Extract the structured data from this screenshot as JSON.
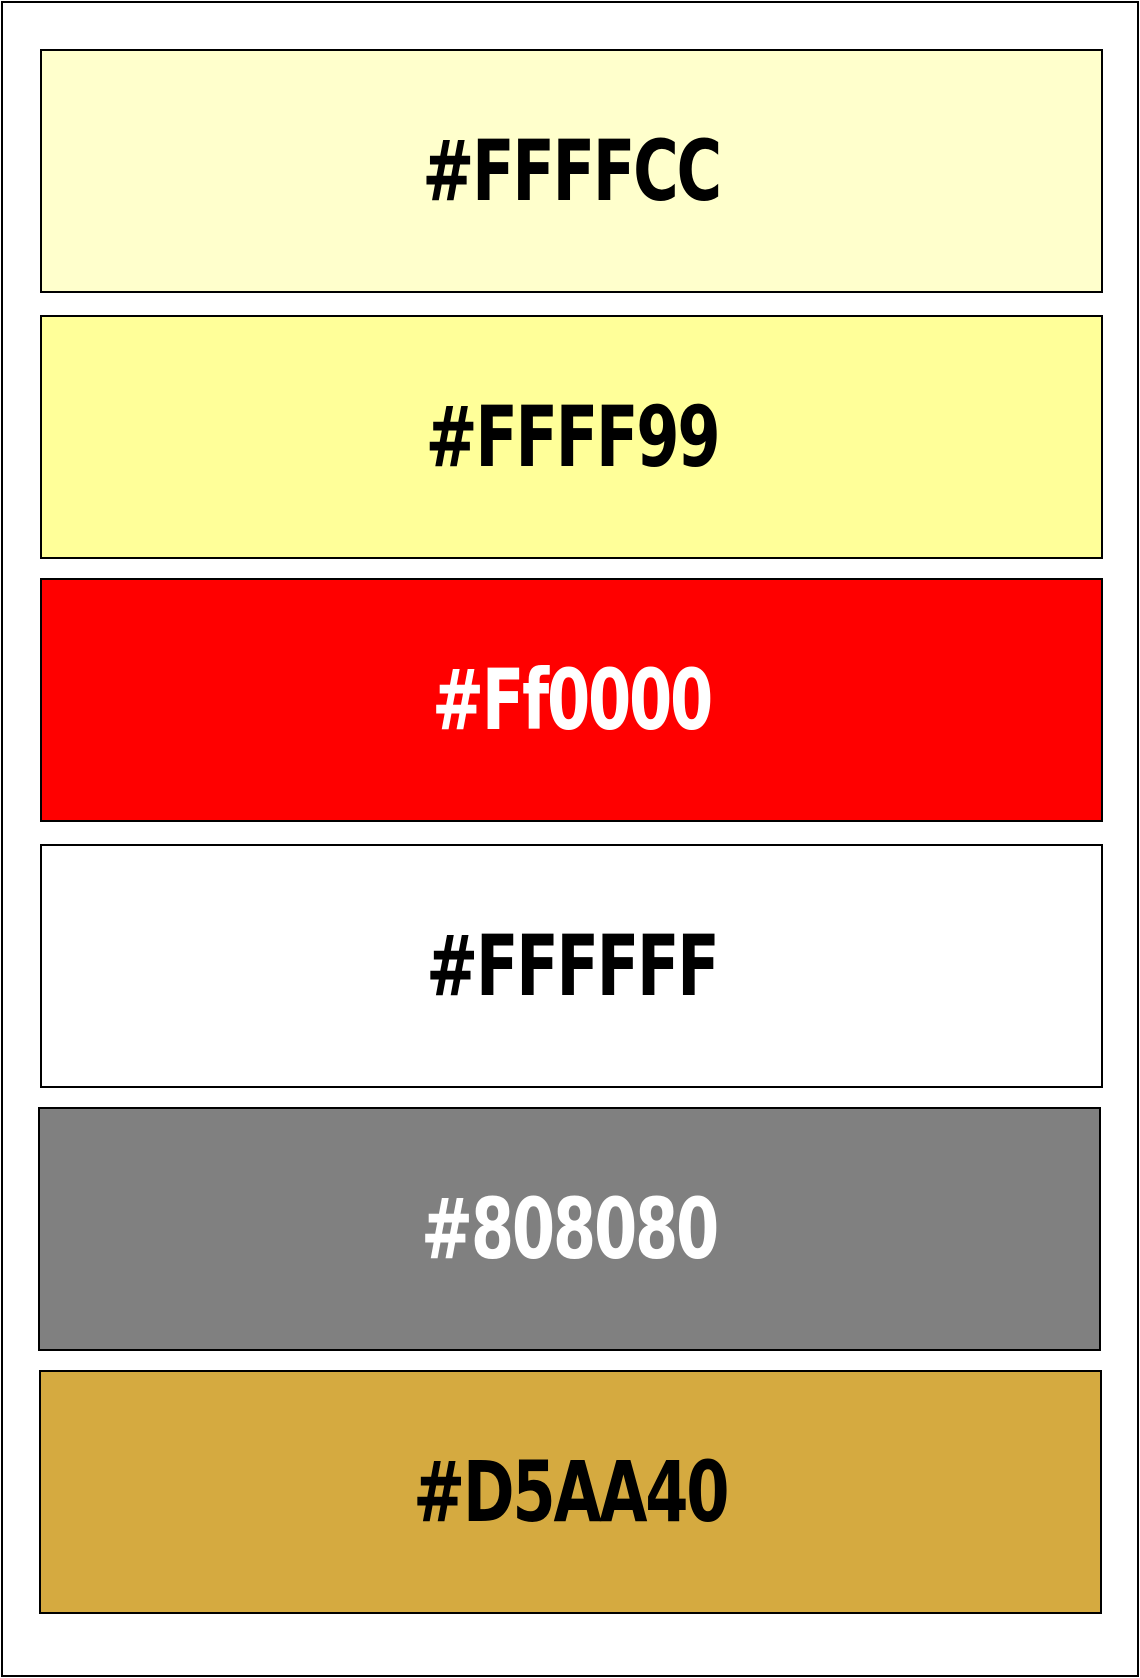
{
  "swatches": [
    {
      "label": "#FFFFCC",
      "fill": "#FFFFCC",
      "text_color": "#000000"
    },
    {
      "label": "#FFFF99",
      "fill": "#FFFF99",
      "text_color": "#000000"
    },
    {
      "label": "#Ff0000",
      "fill": "#FF0000",
      "text_color": "#FFFFFF"
    },
    {
      "label": "#FFFFFF",
      "fill": "#FFFFFF",
      "text_color": "#000000"
    },
    {
      "label": "#808080",
      "fill": "#808080",
      "text_color": "#FFFFFF"
    },
    {
      "label": "#D5AA40",
      "fill": "#D5AA40",
      "text_color": "#000000"
    }
  ]
}
